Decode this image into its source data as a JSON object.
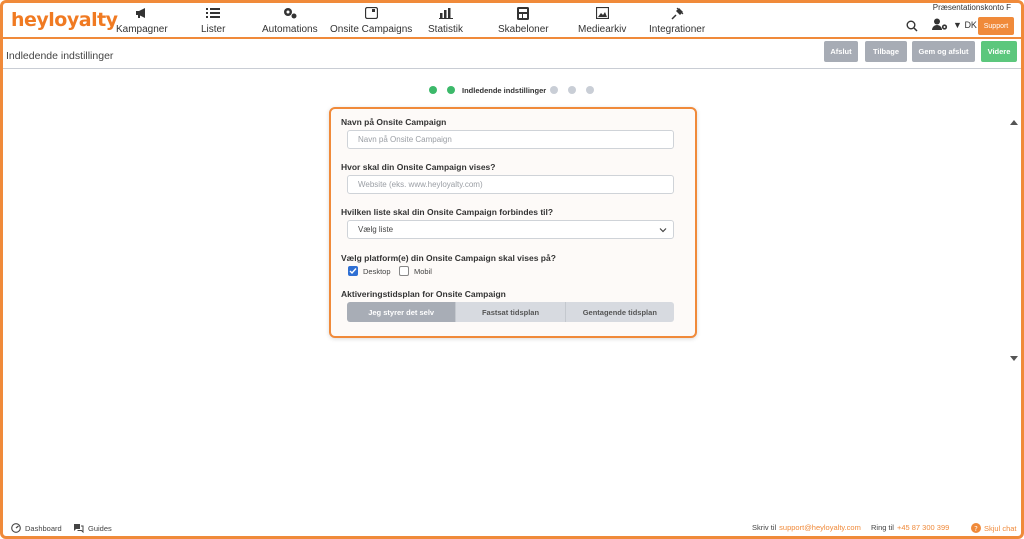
{
  "brand": {
    "logo": "heyloyalty",
    "accent": "#f08a3a"
  },
  "nav": {
    "items": [
      {
        "label": "Kampagner",
        "icon": "megaphone-icon"
      },
      {
        "label": "Lister",
        "icon": "list-icon"
      },
      {
        "label": "Automations",
        "icon": "automation-icon"
      },
      {
        "label": "Onsite Campaigns",
        "icon": "onsite-icon"
      },
      {
        "label": "Statistik",
        "icon": "bar-chart-icon"
      },
      {
        "label": "Skabeloner",
        "icon": "template-icon"
      },
      {
        "label": "Mediearkiv",
        "icon": "image-icon"
      },
      {
        "label": "Integrationer",
        "icon": "plug-icon"
      }
    ],
    "account": "Præsentationskonto F",
    "language": "DK",
    "support_label": "Support"
  },
  "subheader": {
    "title": "Indledende indstillinger",
    "buttons": {
      "afslut": "Afslut",
      "tilbage": "Tilbage",
      "gem": "Gem og afslut",
      "videre": "Videre"
    }
  },
  "stepper": {
    "current_label": "Indledende indstillinger",
    "completed_color": "#3cb96a",
    "pending_color": "#c9ced6"
  },
  "form": {
    "name": {
      "label": "Navn på Onsite Campaign",
      "placeholder": "Navn på Onsite Campaign",
      "value": ""
    },
    "where": {
      "label": "Hvor skal din Onsite Campaign vises?",
      "placeholder": "Website (eks. www.heyloyalty.com)",
      "value": ""
    },
    "list": {
      "label": "Hvilken liste skal din Onsite Campaign forbindes til?",
      "selected": "Vælg liste"
    },
    "platforms": {
      "label": "Vælg platform(e) din Onsite Campaign skal vises på?",
      "desktop": "Desktop",
      "desktop_checked": true,
      "mobile": "Mobil",
      "mobile_checked": false
    },
    "schedule": {
      "label": "Aktiveringstidsplan for Onsite Campaign",
      "options": [
        "Jeg styrer det selv",
        "Fastsat tidsplan",
        "Gentagende tidsplan"
      ],
      "selected": "Jeg styrer det selv"
    }
  },
  "footer": {
    "dashboard": "Dashboard",
    "guides": "Guides",
    "write_prefix": "Skriv til",
    "email": "support@heyloyalty.com",
    "call_prefix": "Ring til",
    "phone": "+45 87 300 399",
    "hide_chat": "Skjul chat"
  }
}
